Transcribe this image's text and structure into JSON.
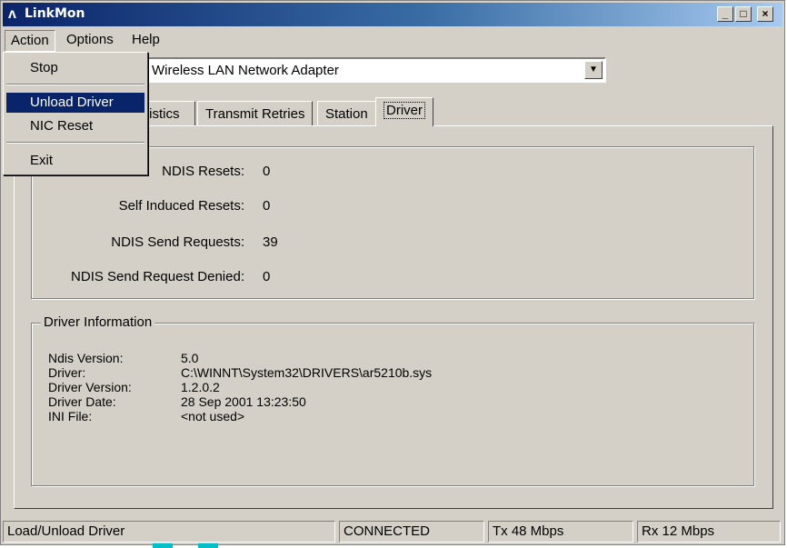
{
  "window": {
    "title": "LinkMon"
  },
  "menubar": {
    "action": "Action",
    "options": "Options",
    "help": "Help"
  },
  "action_menu": {
    "stop": "Stop",
    "unload_driver": "Unload Driver",
    "nic_reset": "NIC Reset",
    "exit": "Exit"
  },
  "adapter": {
    "value": "Wireless LAN Network Adapter"
  },
  "tabs": {
    "statistics": "tistics",
    "transmit_retries": "Transmit Retries",
    "station": "Station",
    "driver": "Driver"
  },
  "stats": [
    {
      "label": "NDIS Resets:",
      "value": "0"
    },
    {
      "label": "Self Induced Resets:",
      "value": "0"
    },
    {
      "label": "NDIS Send Requests:",
      "value": "39"
    },
    {
      "label": "NDIS Send Request Denied:",
      "value": "0"
    }
  ],
  "driver_info": {
    "title": "Driver Information",
    "rows": [
      {
        "label": "Ndis Version:",
        "value": "5.0"
      },
      {
        "label": "Driver:",
        "value": "C:\\WINNT\\System32\\DRIVERS\\ar5210b.sys"
      },
      {
        "label": "Driver Version:",
        "value": "1.2.0.2"
      },
      {
        "label": "Driver Date:",
        "value": "28 Sep 2001 13:23:50"
      },
      {
        "label": "INI File:",
        "value": "<not used>"
      }
    ]
  },
  "status": {
    "message": "Load/Unload Driver",
    "connection": "CONNECTED",
    "tx": "Tx 48 Mbps",
    "rx": "Rx 12 Mbps"
  }
}
